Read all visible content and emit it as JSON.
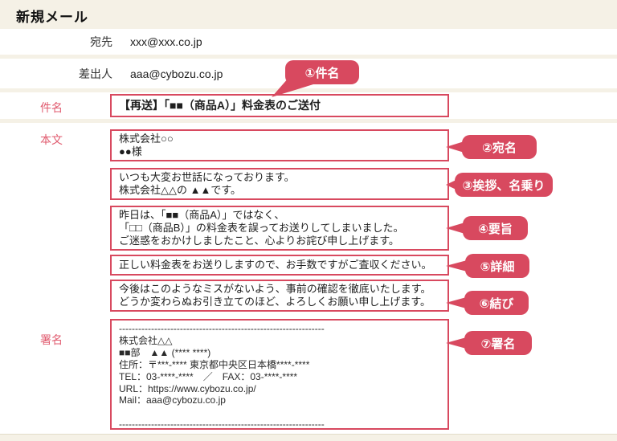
{
  "title": "新規メール",
  "colors": {
    "accent": "#d8495f",
    "field_label_red": "#e05a6e",
    "background_beige": "#f5f1e6"
  },
  "fields": {
    "to": {
      "label": "宛先",
      "value": "xxx@xxx.co.jp"
    },
    "from": {
      "label": "差出人",
      "value": "aaa@cybozu.co.jp"
    },
    "subject": {
      "label": "件名",
      "value": "【再送】「■■（商品A）」料金表のご送付"
    }
  },
  "body": {
    "label": "本文",
    "sections": [
      {
        "text": "株式会社○○\n●●様"
      },
      {
        "text": "いつも大変お世話になっております。\n株式会社△△の ▲▲です。"
      },
      {
        "text": "昨日は、「■■（商品A）」ではなく、\n「□□（商品B）」の料金表を誤ってお送りしてしまいました。\nご迷惑をおかけしましたこと、心よりお詫び申し上げます。"
      },
      {
        "text": "正しい料金表をお送りしますので、お手数ですがご査収ください。"
      },
      {
        "text": "今後はこのようなミスがないよう、事前の確認を徹底いたします。\nどうか変わらぬお引き立てのほど、よろしくお願い申し上げます。"
      }
    ]
  },
  "signature": {
    "label": "署名",
    "text": "----------------------------------------------------------------\n株式会社△△\n■■部　▲▲ (**** ****)\n住所：〒***-**** 東京都中央区日本橋****-****\nTEL：03-****-****　／　FAX：03-****-****\nURL：https://www.cybozu.co.jp/\nMail：aaa@cybozu.co.jp\n\n----------------------------------------------------------------"
  },
  "annotations": [
    {
      "label": "①件名"
    },
    {
      "label": "②宛名"
    },
    {
      "label": "③挨拶、名乗り"
    },
    {
      "label": "④要旨"
    },
    {
      "label": "⑤詳細"
    },
    {
      "label": "⑥結び"
    },
    {
      "label": "⑦署名"
    }
  ]
}
